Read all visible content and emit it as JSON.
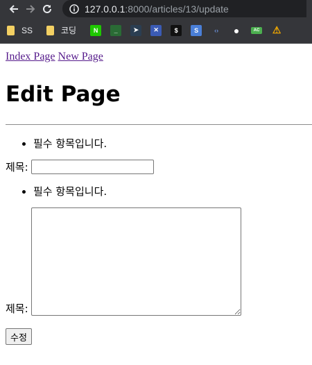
{
  "browser": {
    "url_host": "127.0.0.1",
    "url_rest": ":8000/articles/13/update",
    "bookmarks": [
      {
        "type": "folder",
        "label": "SS"
      },
      {
        "type": "folder",
        "label": "코딩"
      }
    ],
    "bookmark_icons": [
      {
        "name": "naver-icon",
        "glyph": "N",
        "color": "#1ec800"
      },
      {
        "name": "terminal-green-icon",
        "glyph": "_",
        "color": "#2a6b35"
      },
      {
        "name": "bird-icon",
        "glyph": "➤",
        "color": "#2b3e52"
      },
      {
        "name": "x-tool-icon",
        "glyph": "✕",
        "color": "#3b5bb5"
      },
      {
        "name": "dollar-icon",
        "glyph": "$",
        "color": "#111111"
      },
      {
        "name": "s-icon",
        "glyph": "S",
        "color": "#4a7fd8"
      },
      {
        "name": "code-icon",
        "glyph": "‹›",
        "color": "#35363a"
      },
      {
        "name": "github-icon",
        "glyph": "●",
        "color": "#35363a"
      },
      {
        "name": "ac-icon",
        "glyph": "AC",
        "color": "#4caf50"
      },
      {
        "name": "warning-icon",
        "glyph": "⚠",
        "color": "#35363a"
      }
    ]
  },
  "nav": {
    "index_link": "Index Page",
    "new_link": "New Page"
  },
  "page_title": "Edit Page",
  "form": {
    "title_error": "필수 항목입니다.",
    "title_label": "제목:",
    "title_value": "",
    "content_error": "필수 항목입니다.",
    "content_label": "제목:",
    "content_value": "",
    "submit_label": "수정"
  }
}
